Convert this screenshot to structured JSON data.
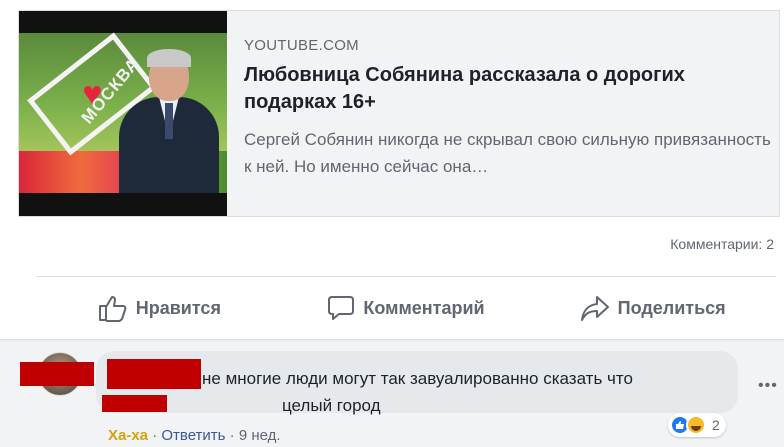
{
  "post": {
    "link_preview": {
      "domain": "YOUTUBE.COM",
      "headline": "Любовница Собянина рассказала о дорогих подарках 16+",
      "description": "Сергей Собянин никогда не скрывал свою сильную привязанность к ней. Но именно сейчас она…",
      "thumbnail_sign_text": "МОСКВА"
    },
    "comments_count": "Комментарии: 2",
    "actions": {
      "like": "Нравится",
      "comment": "Комментарий",
      "share": "Поделиться"
    }
  },
  "comment": {
    "text_line1": "не многие люди могут так завуалированно сказать что",
    "text_line2": "целый город",
    "reaction_count": "2",
    "reaction_icons": [
      "like-icon",
      "haha-icon"
    ],
    "meta": {
      "reaction": "Ха-ха",
      "separator": "·",
      "reply": "Ответить",
      "time": "9 нед."
    }
  },
  "colors": {
    "redaction": "#c00000",
    "haha_label": "#d4a20f",
    "link": "#385898",
    "like_blue": "#2078f4"
  }
}
